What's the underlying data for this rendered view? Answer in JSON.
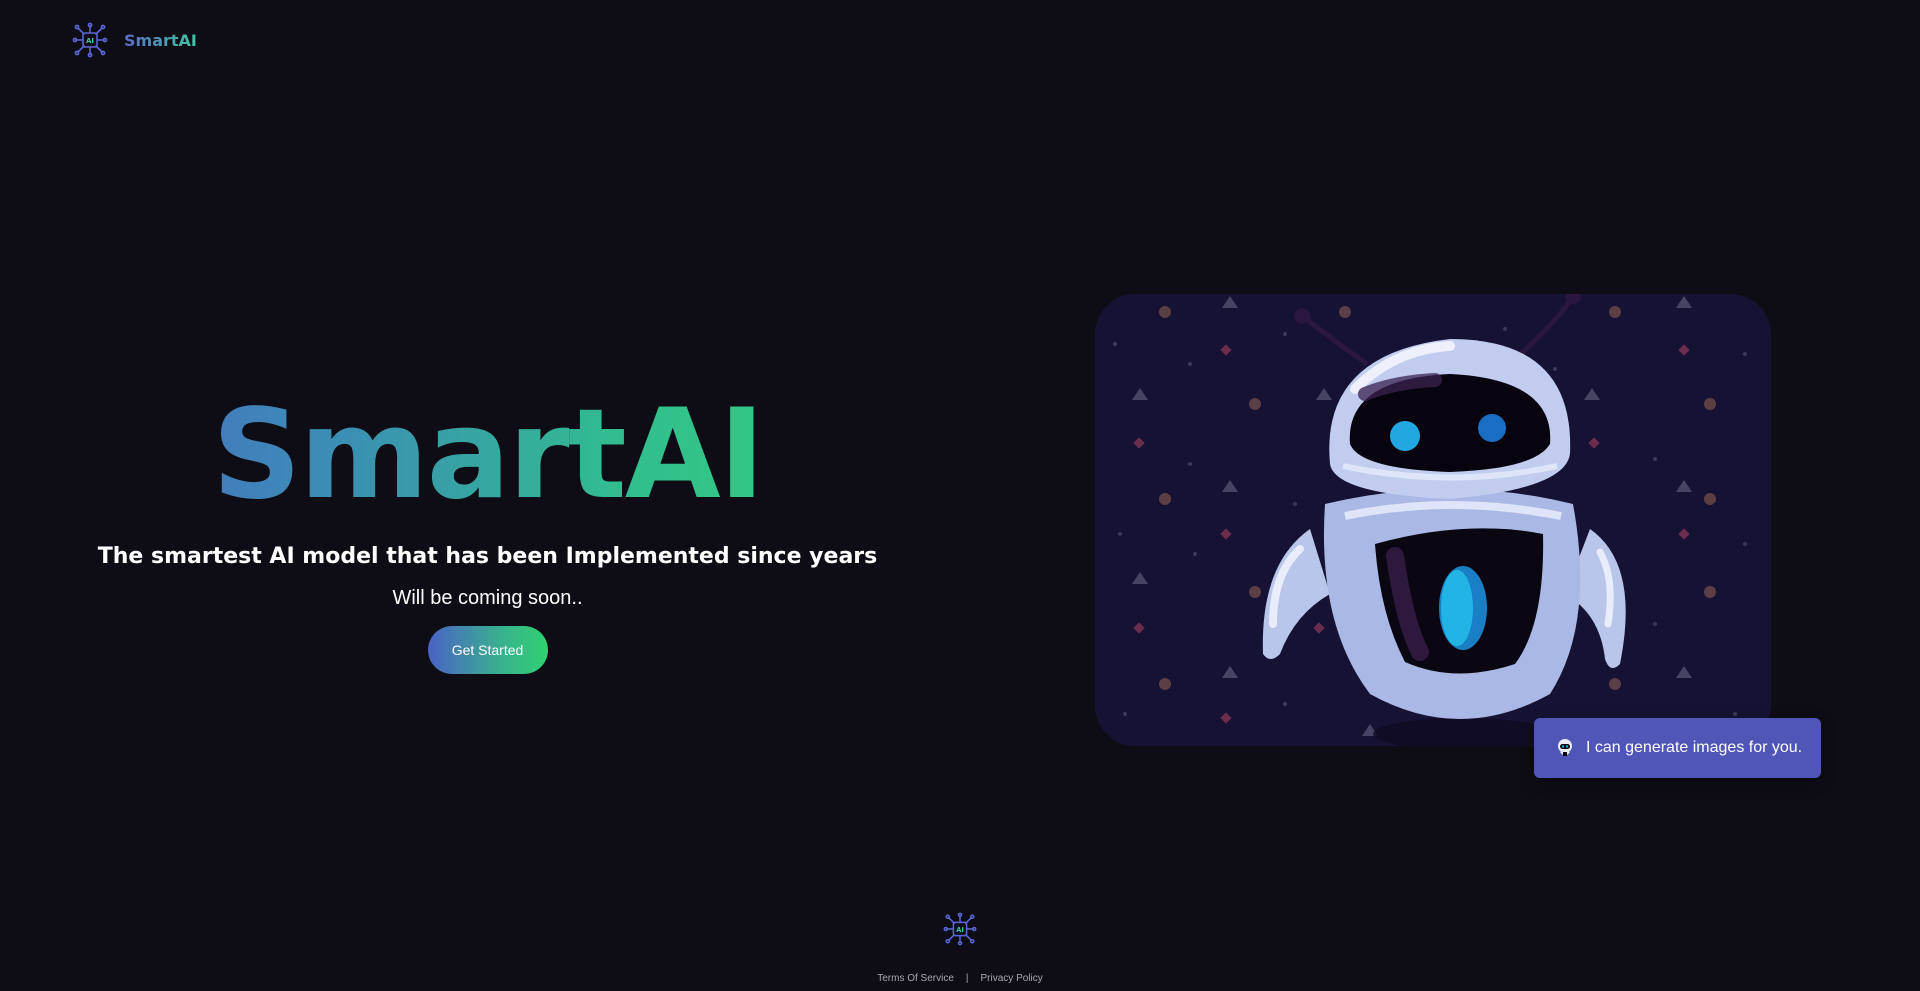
{
  "header": {
    "brand_name": "SmartAI",
    "logo_icon": "ai-chip-icon"
  },
  "hero": {
    "title": "SmartAI",
    "subtitle": "The smartest AI model that has been Implemented since years",
    "note": "Will be coming soon..",
    "cta_label": "Get Started"
  },
  "illustration": {
    "icon": "robot-illustration",
    "bg_color": "#161233"
  },
  "toast": {
    "icon": "robot-icon",
    "text": "I can generate images for you.",
    "bg_color": "#4f56b8"
  },
  "footer": {
    "logo_icon": "ai-chip-icon",
    "terms_label": "Terms Of Service",
    "separator": "|",
    "privacy_label": "Privacy Policy"
  },
  "colors": {
    "background": "#0e0d15",
    "gradient_start": "#4e5ec9",
    "gradient_end": "#34d27a"
  }
}
